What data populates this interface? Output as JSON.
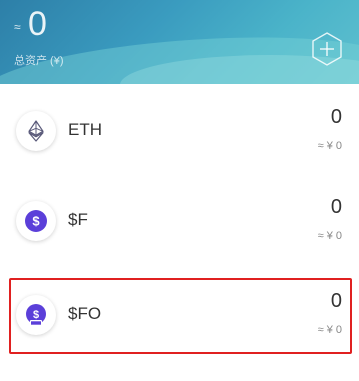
{
  "header": {
    "approx_symbol": "≈",
    "total_value": "0",
    "total_label": "总资产 (¥)",
    "add_icon": "add-hexagon-icon"
  },
  "assets": [
    {
      "name": "ETH",
      "amount": "0",
      "value": "≈ ¥ 0",
      "icon": "ethereum-icon"
    },
    {
      "name": "$F",
      "amount": "0",
      "value": "≈ ¥ 0",
      "icon": "dollar-coin-icon"
    },
    {
      "name": "$FO",
      "amount": "0",
      "value": "≈ ¥ 0",
      "icon": "dollar-coin-fo-icon"
    }
  ],
  "colors": {
    "header_start": "#2d7fa8",
    "header_end": "#5fc0cf",
    "coin_purple": "#5b3fd9",
    "highlight": "#e02020"
  }
}
